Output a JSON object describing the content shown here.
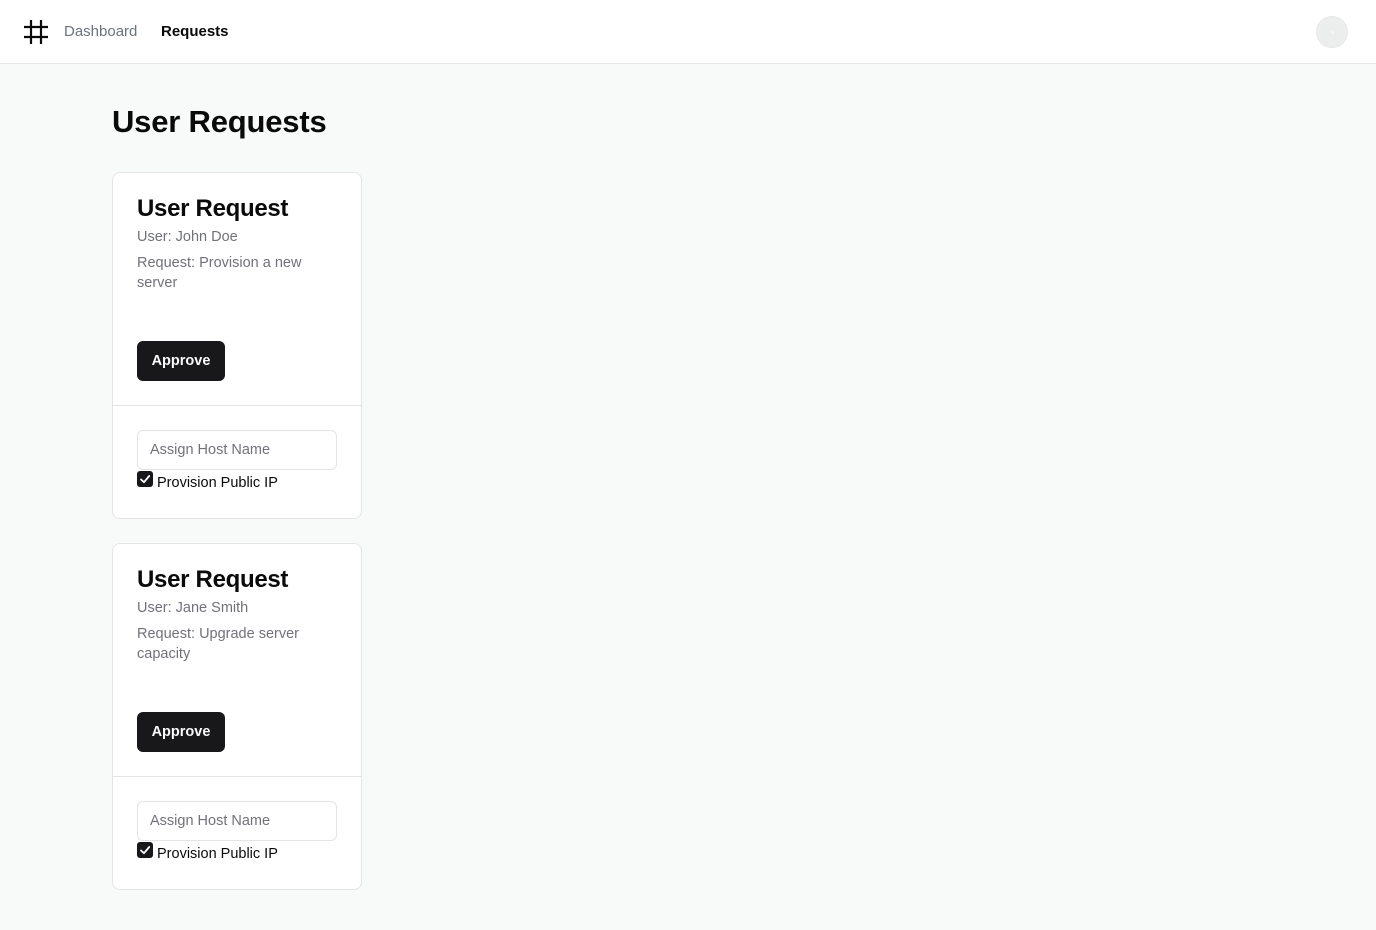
{
  "header": {
    "logo_icon": "hash-icon",
    "nav": [
      {
        "label": "Dashboard"
      },
      {
        "label": "Requests"
      }
    ],
    "avatar_icon": "avatar-icon"
  },
  "page": {
    "title": "User Requests"
  },
  "requests": [
    {
      "title": "User Request",
      "user": "User: John Doe",
      "request": "Request: Provision a new server",
      "approve_label": "Approve",
      "host_placeholder": "Assign Host Name",
      "host_value": "",
      "public_ip_label": "Provision Public IP",
      "public_ip_checked": true
    },
    {
      "title": "User Request",
      "user": "User: Jane Smith",
      "request": "Request: Upgrade server capacity",
      "approve_label": "Approve",
      "host_placeholder": "Assign Host Name",
      "host_value": "",
      "public_ip_label": "Provision Public IP",
      "public_ip_checked": true
    }
  ],
  "colors": {
    "primary": "#18181b",
    "muted_text": "#71717a",
    "border": "#e4e4e7",
    "background": "#f8f9f9"
  }
}
